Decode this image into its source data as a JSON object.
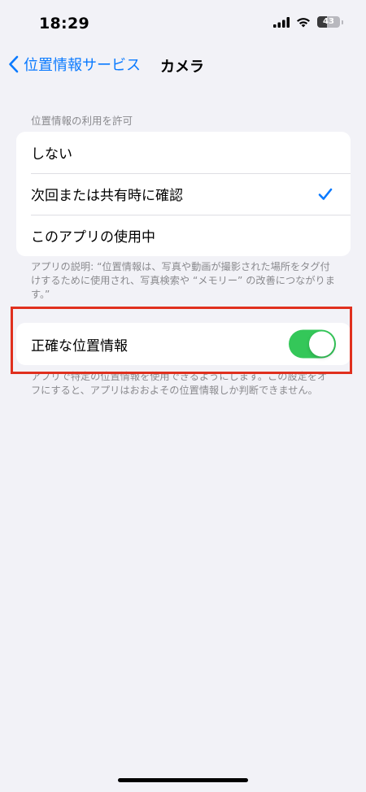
{
  "status_bar": {
    "time": "18:29",
    "battery_level": "43",
    "battery_fraction": 0.43
  },
  "nav": {
    "back_label": "位置情報サービス",
    "title": "カメラ"
  },
  "allow_section": {
    "header": "位置情報の利用を許可",
    "options": [
      {
        "label": "しない",
        "selected": false
      },
      {
        "label": "次回または共有時に確認",
        "selected": true
      },
      {
        "label": "このアプリの使用中",
        "selected": false
      }
    ],
    "footer": "アプリの説明: “位置情報は、写真や動画が撮影された場所をタグ付けするために使用され、写真検索や “メモリー” の改善につながります。”"
  },
  "precise_section": {
    "label": "正確な位置情報",
    "enabled": true,
    "footer": "アプリで特定の位置情報を使用できるようにします。この設定をオフにすると、アプリはおおよその位置情報しか判断できません。"
  },
  "colors": {
    "accent": "#0a7aff",
    "toggle_on": "#34c759",
    "highlight": "#e0301e",
    "background": "#f2f2f7"
  },
  "icons": {
    "back": "chevron-left-icon",
    "check": "checkmark-icon",
    "signal": "cellular-signal-icon",
    "wifi": "wifi-icon",
    "battery": "battery-icon"
  }
}
